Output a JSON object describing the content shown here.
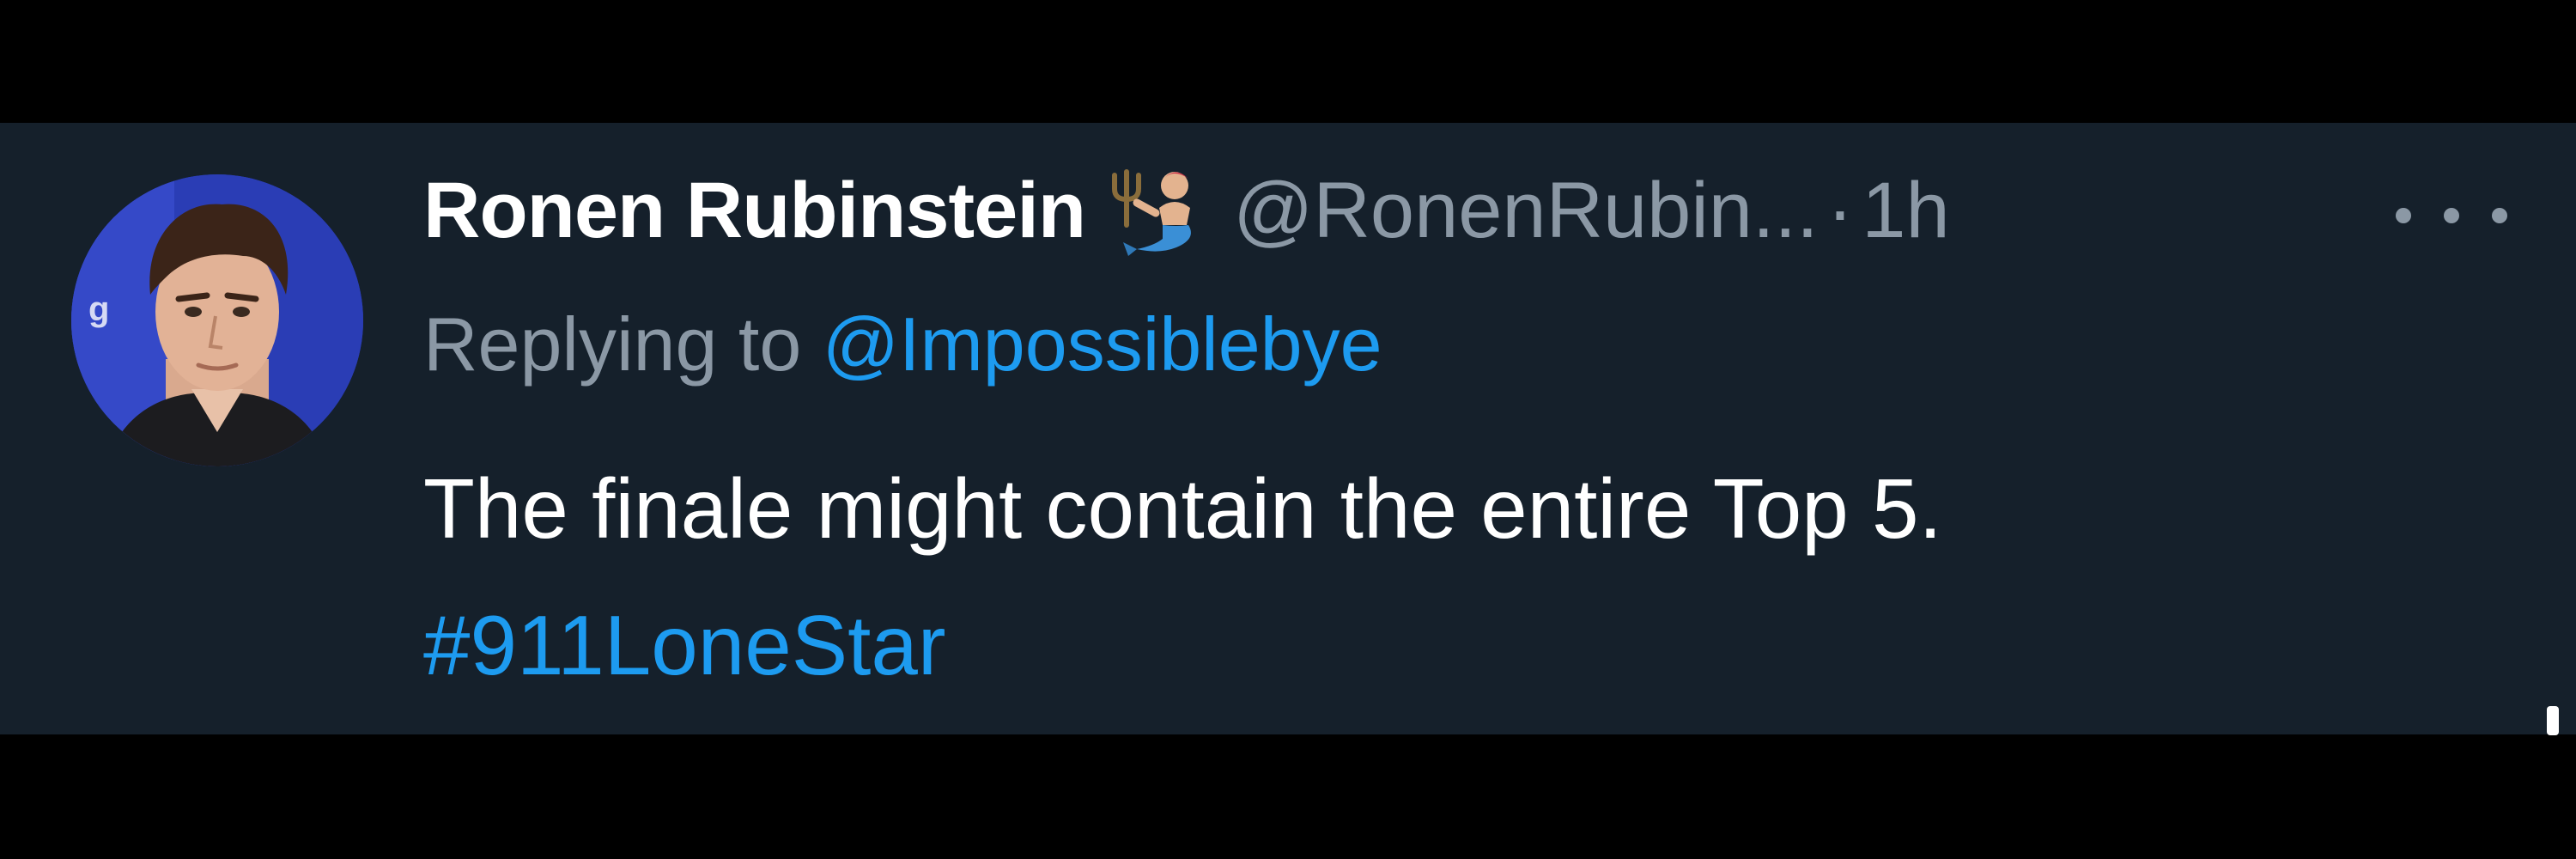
{
  "tweet": {
    "display_name": "Ronen Rubinstein",
    "name_emoji": "mermaid-with-trident-emoji",
    "handle": "@RonenRubin...",
    "separator": "·",
    "time": "1h",
    "more_icon": "more-options-icon",
    "replying_prefix": "Replying to ",
    "replying_handle": "@Impossiblebye",
    "text": "The finale might contain the entire Top 5.",
    "hashtag": "#911LoneStar"
  },
  "colors": {
    "background": "#15202b",
    "outer": "#000000",
    "primary_text": "#ffffff",
    "secondary_text": "#8b98a5",
    "link": "#1d9bf0"
  }
}
